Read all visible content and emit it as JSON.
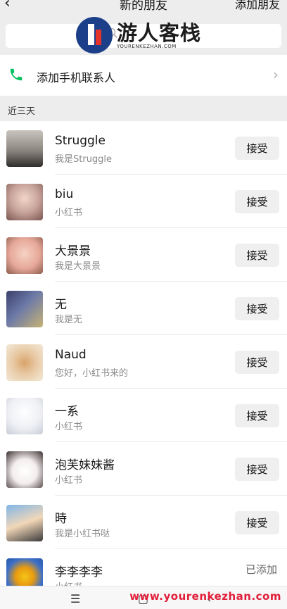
{
  "header": {
    "back_icon": "‹",
    "title": "新的朋友",
    "add_label": "添加朋友"
  },
  "search": {
    "icon": "search-icon"
  },
  "watermark": {
    "name": "游人客栈",
    "sub": "YOURENKEZHAN.COM",
    "url": "www.yourenkezhan.com"
  },
  "phone_contacts": {
    "label": "添加手机联系人",
    "icon": "phone-icon",
    "chevron": "›"
  },
  "section": {
    "label": "近三天"
  },
  "requests": [
    {
      "name": "Struggle",
      "message": "我是Struggle",
      "action": "接受"
    },
    {
      "name": "biu",
      "message": "小红书",
      "action": "接受"
    },
    {
      "name": "大景景",
      "message": "我是大景景",
      "action": "接受"
    },
    {
      "name": "无",
      "message": "我是无",
      "action": "接受"
    },
    {
      "name": "Naud",
      "message": "您好，小红书来的",
      "action": "接受"
    },
    {
      "name": "一系",
      "message": "小红书",
      "action": "接受"
    },
    {
      "name": "泡芙妹妹酱",
      "message": "小红书",
      "action": "接受"
    },
    {
      "name": "時",
      "message": "我是小红书哒",
      "action": "接受"
    },
    {
      "name": "李李李李",
      "message": "小红书",
      "status": "已添加"
    }
  ],
  "navbar": {
    "menu": "☰",
    "home": "▢",
    "back": "‹"
  },
  "colors": {
    "accent_green": "#07c160",
    "watermark_red": "#e21e3a",
    "logo_blue": "#1c3f8a"
  }
}
